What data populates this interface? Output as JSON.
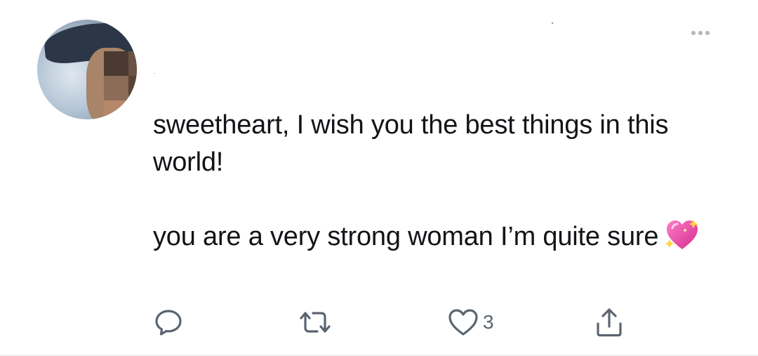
{
  "tweet": {
    "paragraph1": "sweetheart, I wish you the best things in this world!",
    "paragraph2": "you are a very strong woman I’m quite sure",
    "emoji": "sparkling-heart",
    "like_count": "3"
  },
  "actions": {
    "reply_icon": "reply-icon",
    "retweet_icon": "retweet-icon",
    "like_icon": "heart-icon",
    "share_icon": "share-icon",
    "more_icon": "more-icon"
  },
  "colors": {
    "text": "#121417",
    "icon": "#5b6570",
    "heart_emoji": "#e8459f"
  }
}
